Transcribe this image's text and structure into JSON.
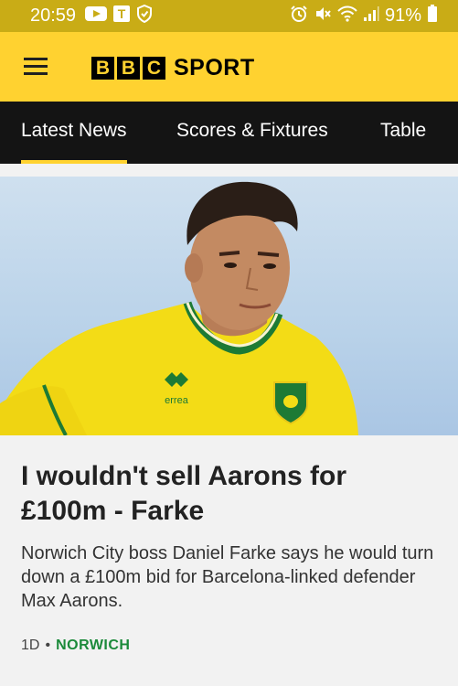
{
  "status_bar": {
    "time": "20:59",
    "battery": "91%",
    "left_icons": [
      "youtube-icon",
      "t-notification-icon",
      "shield-icon"
    ],
    "right_icons": [
      "alarm-icon",
      "mute-icon",
      "wifi-icon",
      "signal-icon",
      "battery-icon"
    ]
  },
  "header": {
    "logo_letters": [
      "B",
      "B",
      "C"
    ],
    "logo_word": "SPORT"
  },
  "tabs": [
    {
      "label": "Latest News",
      "active": true
    },
    {
      "label": "Scores & Fixtures",
      "active": false
    },
    {
      "label": "Table",
      "active": false
    }
  ],
  "article": {
    "headline": "I wouldn't sell Aarons for £100m - Farke",
    "summary": "Norwich City boss Daniel Farke says he would turn down a £100m bid for Barcelona-linked defender Max Aarons.",
    "age": "1D",
    "topic": "NORWICH",
    "kit_brand": "errea"
  },
  "colors": {
    "status_bar": "#c9ac16",
    "brand_yellow": "#ffd230",
    "tab_bar": "#141414",
    "topic_green": "#1b8a3a"
  }
}
